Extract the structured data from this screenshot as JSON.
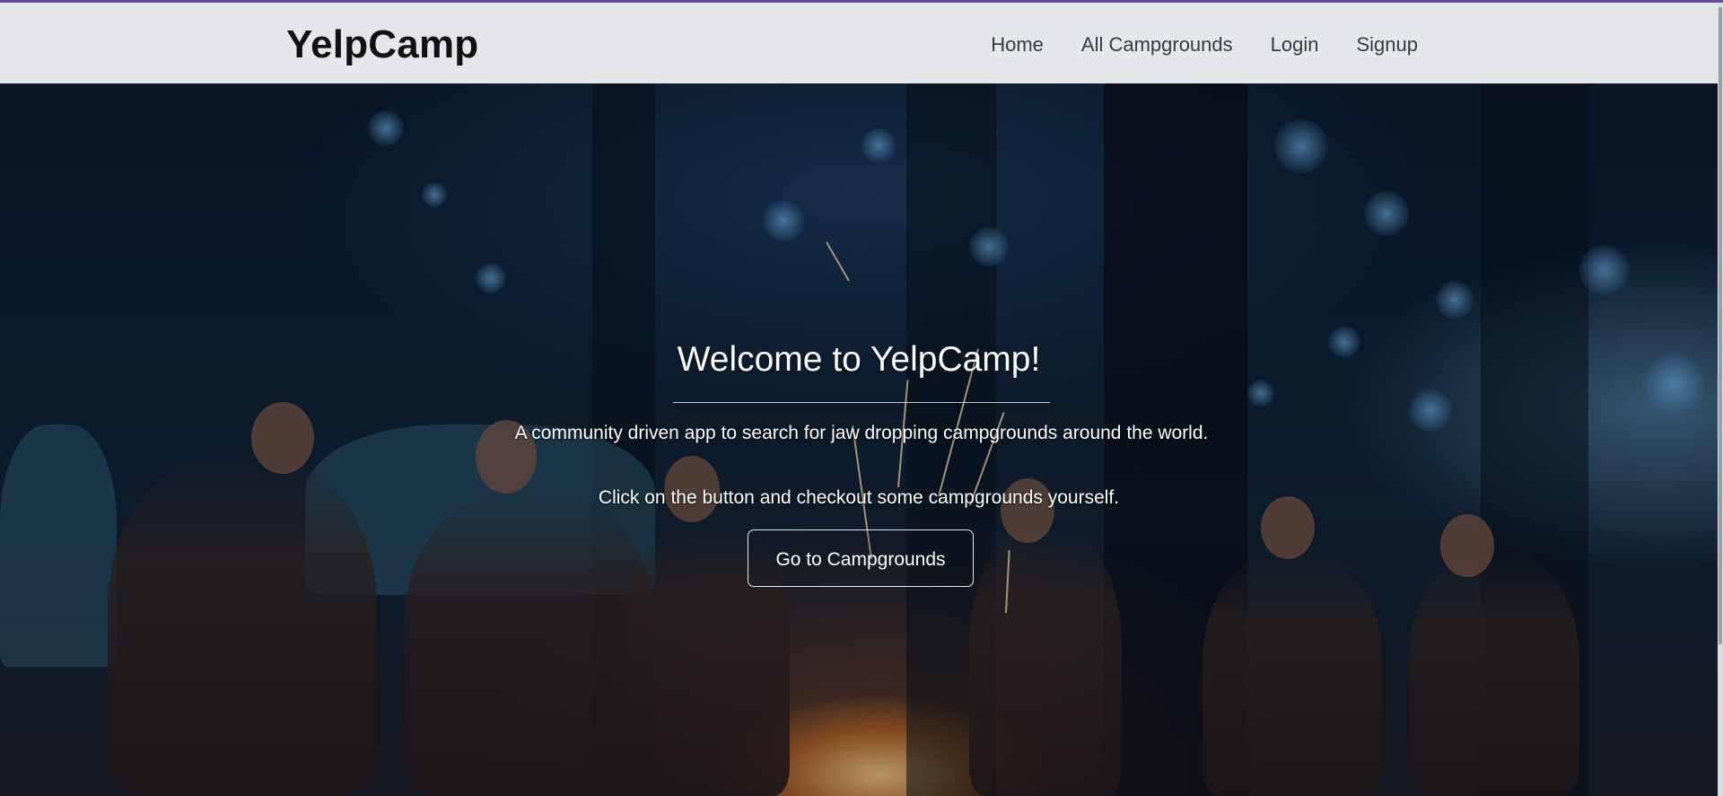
{
  "navbar": {
    "brand": "YelpCamp",
    "links": [
      {
        "label": "Home"
      },
      {
        "label": "All Campgrounds"
      },
      {
        "label": "Login"
      },
      {
        "label": "Signup"
      }
    ]
  },
  "hero": {
    "title": "Welcome to YelpCamp!",
    "description": "A community driven app to search for jaw dropping campgrounds around the world.",
    "description2": "Click on the button and checkout some campgrounds yourself.",
    "button_label": "Go to Campgrounds",
    "background": "campfire-night-forest-photo"
  },
  "colors": {
    "navbar_bg": "#e6e7ea",
    "accent_line": "#6a4c93",
    "hero_text": "#ffffff"
  }
}
